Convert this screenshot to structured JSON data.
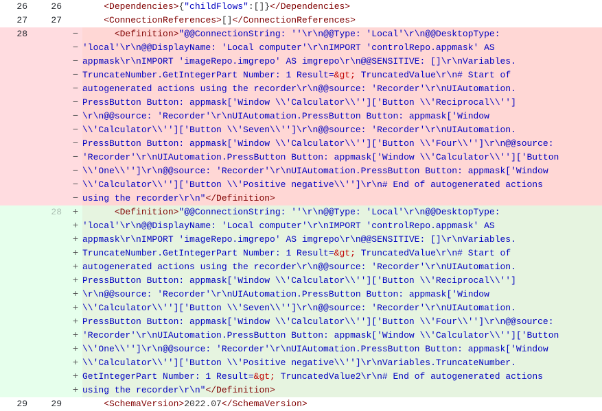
{
  "diff": {
    "lines": [
      {
        "type": "context",
        "old": "26",
        "new": "26",
        "marker": "",
        "code": "    <tag><Dependencies></tag>{<q>\"childFlows\"</q>:[]}<tag></Dependencies></tag>"
      },
      {
        "type": "context",
        "old": "27",
        "new": "27",
        "marker": "",
        "code": "    <tag><ConnectionReferences></tag>[]<tag></ConnectionReferences></tag>"
      },
      {
        "type": "del",
        "old": "28",
        "new": "",
        "marker": "−",
        "first": true,
        "code": "      <tag><Definition></tag><q>\"@@ConnectionString: ''\\r\\n@@Type: 'Local'\\r\\n@@DesktopType: </q>"
      },
      {
        "type": "del",
        "old": "",
        "new": "",
        "marker": "−",
        "code": "<q>'local'\\r\\n@@DisplayName: 'Local computer'\\r\\nIMPORT 'controlRepo.appmask' AS </q>"
      },
      {
        "type": "del",
        "old": "",
        "new": "",
        "marker": "−",
        "code": "<q>appmask\\r\\nIMPORT 'imageRepo.imgrepo' AS imgrepo\\r\\n@@SENSITIVE: []\\r\\nVariables.</q>"
      },
      {
        "type": "del",
        "old": "",
        "new": "",
        "marker": "−",
        "code": "<q>TruncateNumber.GetIntegerPart Number: 1 Result=</q><ent>&amp;gt;</ent><q> TruncatedValue\\r\\n# Start of </q>"
      },
      {
        "type": "del",
        "old": "",
        "new": "",
        "marker": "−",
        "code": "<q>autogenerated actions using the recorder\\r\\n@@source: 'Recorder'\\r\\nUIAutomation.</q>"
      },
      {
        "type": "del",
        "old": "",
        "new": "",
        "marker": "−",
        "code": "<q>PressButton Button: appmask['Window \\\\'Calculator\\\\'']['Button \\\\'Reciprocal\\\\'']</q>"
      },
      {
        "type": "del",
        "old": "",
        "new": "",
        "marker": "−",
        "code": "<q>\\r\\n@@source: 'Recorder'\\r\\nUIAutomation.PressButton Button: appmask['Window </q>"
      },
      {
        "type": "del",
        "old": "",
        "new": "",
        "marker": "−",
        "code": "<q>\\\\'Calculator\\\\'']['Button \\\\'Seven\\\\'']\\r\\n@@source: 'Recorder'\\r\\nUIAutomation.</q>"
      },
      {
        "type": "del",
        "old": "",
        "new": "",
        "marker": "−",
        "code": "<q>PressButton Button: appmask['Window \\\\'Calculator\\\\'']['Button \\\\'Four\\\\'']\\r\\n@@source: </q>"
      },
      {
        "type": "del",
        "old": "",
        "new": "",
        "marker": "−",
        "code": "<q>'Recorder'\\r\\nUIAutomation.PressButton Button: appmask['Window \\\\'Calculator\\\\'']['Button </q>"
      },
      {
        "type": "del",
        "old": "",
        "new": "",
        "marker": "−",
        "code": "<q>\\\\'One\\\\'']\\r\\n@@source: 'Recorder'\\r\\nUIAutomation.PressButton Button: appmask['Window </q>"
      },
      {
        "type": "del",
        "old": "",
        "new": "",
        "marker": "−",
        "code": "<q>\\\\'Calculator\\\\'']['Button \\\\'Positive negative\\\\'']\\r\\n# End of autogenerated actions </q>"
      },
      {
        "type": "del",
        "old": "",
        "new": "",
        "marker": "−",
        "code": "<q>using the recorder\\r\\n\"</q><tag></Definition></tag>"
      },
      {
        "type": "add",
        "old": "",
        "new": "28",
        "marker": "+",
        "code": "      <tag><Definition></tag><q>\"@@ConnectionString: ''\\r\\n@@Type: 'Local'\\r\\n@@DesktopType: </q>"
      },
      {
        "type": "add",
        "old": "",
        "new": "",
        "marker": "+",
        "code": "<q>'local'\\r\\n@@DisplayName: 'Local computer'\\r\\nIMPORT 'controlRepo.appmask' AS </q>"
      },
      {
        "type": "add",
        "old": "",
        "new": "",
        "marker": "+",
        "code": "<q>appmask\\r\\nIMPORT 'imageRepo.imgrepo' AS imgrepo\\r\\n@@SENSITIVE: []\\r\\nVariables.</q>"
      },
      {
        "type": "add",
        "old": "",
        "new": "",
        "marker": "+",
        "code": "<q>TruncateNumber.GetIntegerPart Number: 1 Result=</q><ent>&amp;gt;</ent><q> TruncatedValue\\r\\n# Start of </q>"
      },
      {
        "type": "add",
        "old": "",
        "new": "",
        "marker": "+",
        "code": "<q>autogenerated actions using the recorder\\r\\n@@source: 'Recorder'\\r\\nUIAutomation.</q>"
      },
      {
        "type": "add",
        "old": "",
        "new": "",
        "marker": "+",
        "code": "<q>PressButton Button: appmask['Window \\\\'Calculator\\\\'']['Button \\\\'Reciprocal\\\\'']</q>"
      },
      {
        "type": "add",
        "old": "",
        "new": "",
        "marker": "+",
        "code": "<q>\\r\\n@@source: 'Recorder'\\r\\nUIAutomation.PressButton Button: appmask['Window </q>"
      },
      {
        "type": "add",
        "old": "",
        "new": "",
        "marker": "+",
        "code": "<q>\\\\'Calculator\\\\'']['Button \\\\'Seven\\\\'']\\r\\n@@source: 'Recorder'\\r\\nUIAutomation.</q>"
      },
      {
        "type": "add",
        "old": "",
        "new": "",
        "marker": "+",
        "code": "<q>PressButton Button: appmask['Window \\\\'Calculator\\\\'']['Button \\\\'Four\\\\'']\\r\\n@@source: </q>"
      },
      {
        "type": "add",
        "old": "",
        "new": "",
        "marker": "+",
        "code": "<q>'Recorder'\\r\\nUIAutomation.PressButton Button: appmask['Window \\\\'Calculator\\\\'']['Button </q>"
      },
      {
        "type": "add",
        "old": "",
        "new": "",
        "marker": "+",
        "code": "<q>\\\\'One\\\\'']\\r\\n@@source: 'Recorder'\\r\\nUIAutomation.PressButton Button: appmask['Window </q>"
      },
      {
        "type": "add",
        "old": "",
        "new": "",
        "marker": "+",
        "code": "<q>\\\\'Calculator\\\\'']['Button \\\\'Positive negative\\\\'']\\r\\nVariables.TruncateNumber.</q>"
      },
      {
        "type": "add",
        "old": "",
        "new": "",
        "marker": "+",
        "code": "<q>GetIntegerPart Number: 1 Result=</q><ent>&amp;gt;</ent><q> TruncatedValue2\\r\\n# End of autogenerated actions </q>"
      },
      {
        "type": "add",
        "old": "",
        "new": "",
        "marker": "+",
        "code": "<q>using the recorder\\r\\n\"</q><tag></Definition></tag>"
      },
      {
        "type": "context",
        "old": "29",
        "new": "29",
        "marker": "",
        "code": "    <tag><SchemaVersion></tag>2022.07<tag></SchemaVersion></tag>"
      }
    ]
  }
}
